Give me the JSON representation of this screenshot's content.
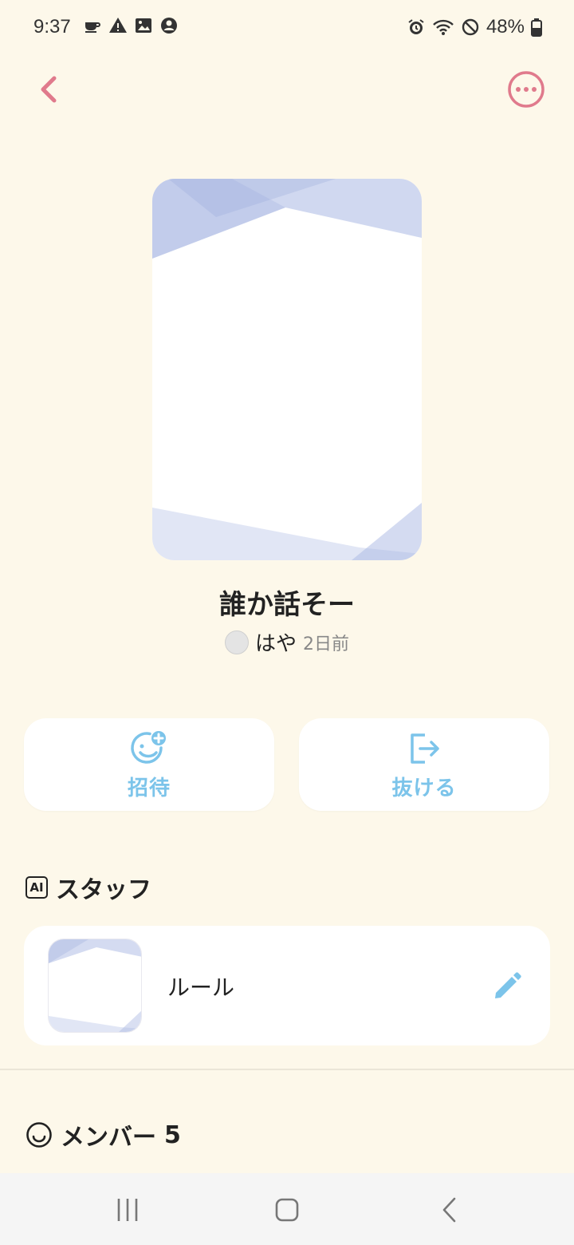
{
  "status_bar": {
    "time": "9:37",
    "battery": "48%",
    "left_icons": [
      "coffee-icon",
      "warning-icon",
      "image-icon",
      "account-icon"
    ],
    "right_icons": [
      "alarm-icon",
      "wifi-icon",
      "do-not-disturb-icon",
      "battery-icon"
    ]
  },
  "room": {
    "title": "誰か話そー",
    "owner_name": "はや",
    "created": "2日前"
  },
  "actions": {
    "invite_label": "招待",
    "leave_label": "抜ける"
  },
  "staff": {
    "section_title": "スタッフ",
    "badge": "AI",
    "items": [
      {
        "name": "ルール"
      }
    ]
  },
  "members": {
    "section_title": "メンバー",
    "count": "5"
  },
  "colors": {
    "background": "#fdf8ea",
    "accent_pink": "#e07a8c",
    "accent_blue": "#7cc4ea",
    "cover_tint": "#aab8e3"
  }
}
